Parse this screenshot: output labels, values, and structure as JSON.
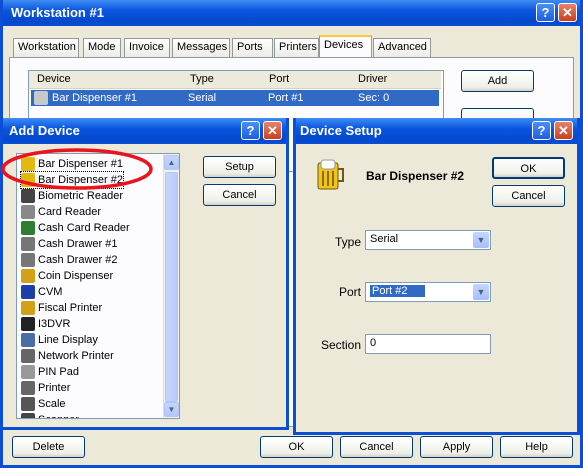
{
  "main": {
    "title": "Workstation #1",
    "tabs": [
      "Workstation",
      "Mode",
      "Invoice",
      "Messages",
      "Ports",
      "Printers",
      "Devices",
      "Advanced"
    ],
    "active_tab": "Devices",
    "columns": [
      "Device",
      "Type",
      "Port",
      "Driver"
    ],
    "rows": [
      {
        "device": "Bar Dispenser #1",
        "type": "Serial",
        "port": "Port #1",
        "driver": "Sec: 0"
      }
    ],
    "add_label": "Add",
    "delete_label": "Delete",
    "ok_label": "OK",
    "cancel_label": "Cancel",
    "apply_label": "Apply",
    "help_label": "Help"
  },
  "add_device": {
    "title": "Add Device",
    "setup_label": "Setup",
    "cancel_label": "Cancel",
    "items": [
      {
        "label": "Bar Dispenser #1",
        "icon": "bar-dispenser-icon"
      },
      {
        "label": "Bar Dispenser #2",
        "icon": "bar-dispenser-icon"
      },
      {
        "label": "Biometric Reader",
        "icon": "biometric-reader-icon"
      },
      {
        "label": "Card Reader",
        "icon": "card-reader-icon"
      },
      {
        "label": "Cash Card Reader",
        "icon": "cash-card-reader-icon"
      },
      {
        "label": "Cash Drawer #1",
        "icon": "cash-drawer-icon"
      },
      {
        "label": "Cash Drawer #2",
        "icon": "cash-drawer-icon"
      },
      {
        "label": "Coin Dispenser",
        "icon": "coin-dispenser-icon"
      },
      {
        "label": "CVM",
        "icon": "cvm-icon"
      },
      {
        "label": "Fiscal Printer",
        "icon": "fiscal-printer-icon"
      },
      {
        "label": "I3DVR",
        "icon": "dvr-icon"
      },
      {
        "label": "Line Display",
        "icon": "line-display-icon"
      },
      {
        "label": "Network Printer",
        "icon": "network-printer-icon"
      },
      {
        "label": "PIN Pad",
        "icon": "pin-pad-icon"
      },
      {
        "label": "Printer",
        "icon": "printer-icon"
      },
      {
        "label": "Scale",
        "icon": "scale-icon"
      },
      {
        "label": "Scanner",
        "icon": "scanner-icon"
      }
    ]
  },
  "device_setup": {
    "title": "Device Setup",
    "device_name": "Bar Dispenser #2",
    "ok_label": "OK",
    "cancel_label": "Cancel",
    "type_label": "Type",
    "type_value": "Serial",
    "port_label": "Port",
    "port_value": "Port #2",
    "section_label": "Section",
    "section_value": "0"
  },
  "colors": {
    "highlight": "#e8141e",
    "selection": "#316ac5",
    "title_blue": "#0a4fd6"
  }
}
